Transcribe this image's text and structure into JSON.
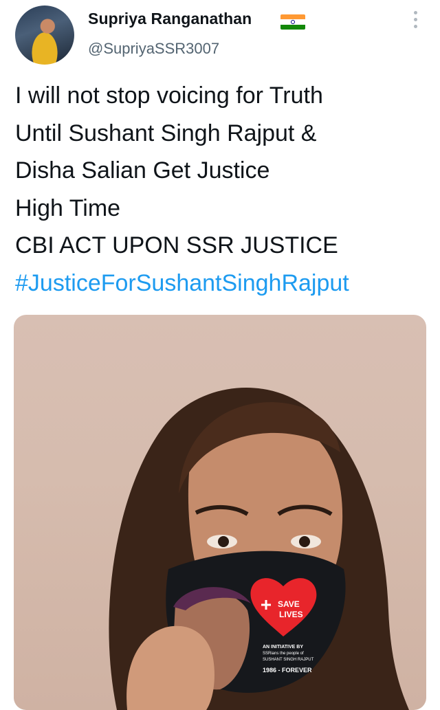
{
  "author": {
    "display_name": "Supriya Ranganathan",
    "handle": "@SupriyaSSR3007",
    "flag_icon": "india-flag-icon"
  },
  "tweet": {
    "lines": [
      "I will not stop voicing for Truth",
      "Until Sushant Singh Rajput &",
      "Disha Salian Get Justice",
      "High Time",
      "CBI ACT UPON SSR JUSTICE"
    ],
    "hashtag": "#JusticeForSushantSinghRajput"
  },
  "media": {
    "mask_text": [
      "SAVE",
      "LIVES"
    ],
    "mask_small_text": [
      "AN INITIATIVE BY",
      "SSRians the people of",
      "SUSHANT SINGH RAJPUT",
      "1986 - FOREVER"
    ]
  },
  "colors": {
    "hashtag": "#1d9bf0",
    "text": "#0f1419",
    "secondary": "#536471",
    "heart": "#e8252b"
  }
}
